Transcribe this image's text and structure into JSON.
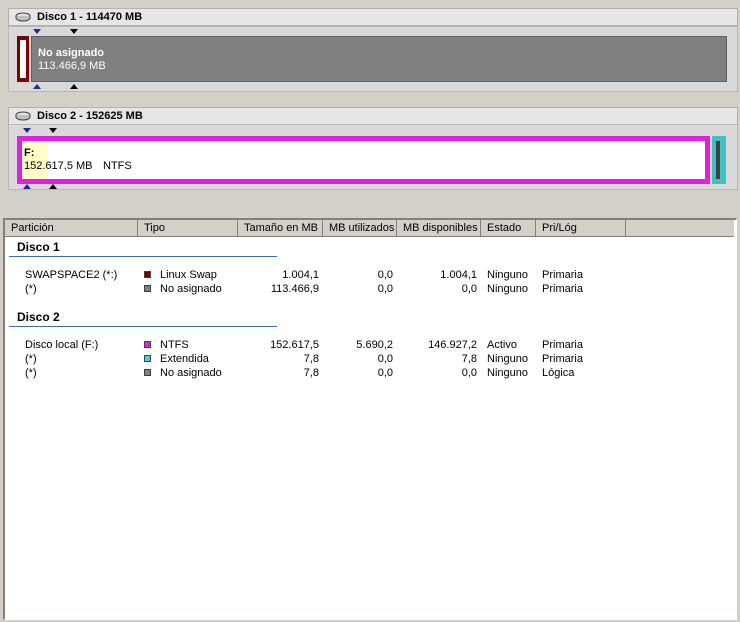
{
  "disks": [
    {
      "title": "Disco 1 - 114470 MB",
      "partitions": [
        {
          "name": "No asignado",
          "size": "113.466,9 MB",
          "fs": "",
          "color": "#808080"
        }
      ],
      "leading_color": "#800000"
    },
    {
      "title": "Disco 2 - 152625 MB",
      "partitions": [
        {
          "name": "F:",
          "size": "152.617,5 MB",
          "fs": "NTFS",
          "color": "#e020e0"
        }
      ],
      "trailing_color": "#40c0c0"
    }
  ],
  "table": {
    "columns": [
      "Partición",
      "Tipo",
      "Tamaño en MB",
      "MB utilizados",
      "MB disponibles",
      "Estado",
      "Pri/Lóg"
    ],
    "groups": [
      {
        "label": "Disco 1",
        "rows": [
          {
            "partition": "SWAPSPACE2 (*:)",
            "type": "Linux Swap",
            "type_color": "#800000",
            "size": "1.004,1",
            "used": "0,0",
            "free": "1.004,1",
            "state": "Ninguno",
            "prilog": "Primaria"
          },
          {
            "partition": "(*)",
            "type": "No asignado",
            "type_color": "#808080",
            "size": "113.466,9",
            "used": "0,0",
            "free": "0,0",
            "state": "Ninguno",
            "prilog": "Primaria"
          }
        ]
      },
      {
        "label": "Disco 2",
        "rows": [
          {
            "partition": "Disco local (F:)",
            "type": "NTFS",
            "type_color": "#e020e0",
            "size": "152.617,5",
            "used": "5.690,2",
            "free": "146.927,2",
            "state": "Activo",
            "prilog": "Primaria"
          },
          {
            "partition": "(*)",
            "type": "Extendida",
            "type_color": "#40d0e0",
            "size": "7,8",
            "used": "0,0",
            "free": "7,8",
            "state": "Ninguno",
            "prilog": "Primaria"
          },
          {
            "partition": "(*)",
            "type": "No asignado",
            "type_color": "#808080",
            "size": "7,8",
            "used": "0,0",
            "free": "0,0",
            "state": "Ninguno",
            "prilog": "Lógica"
          }
        ]
      }
    ]
  }
}
